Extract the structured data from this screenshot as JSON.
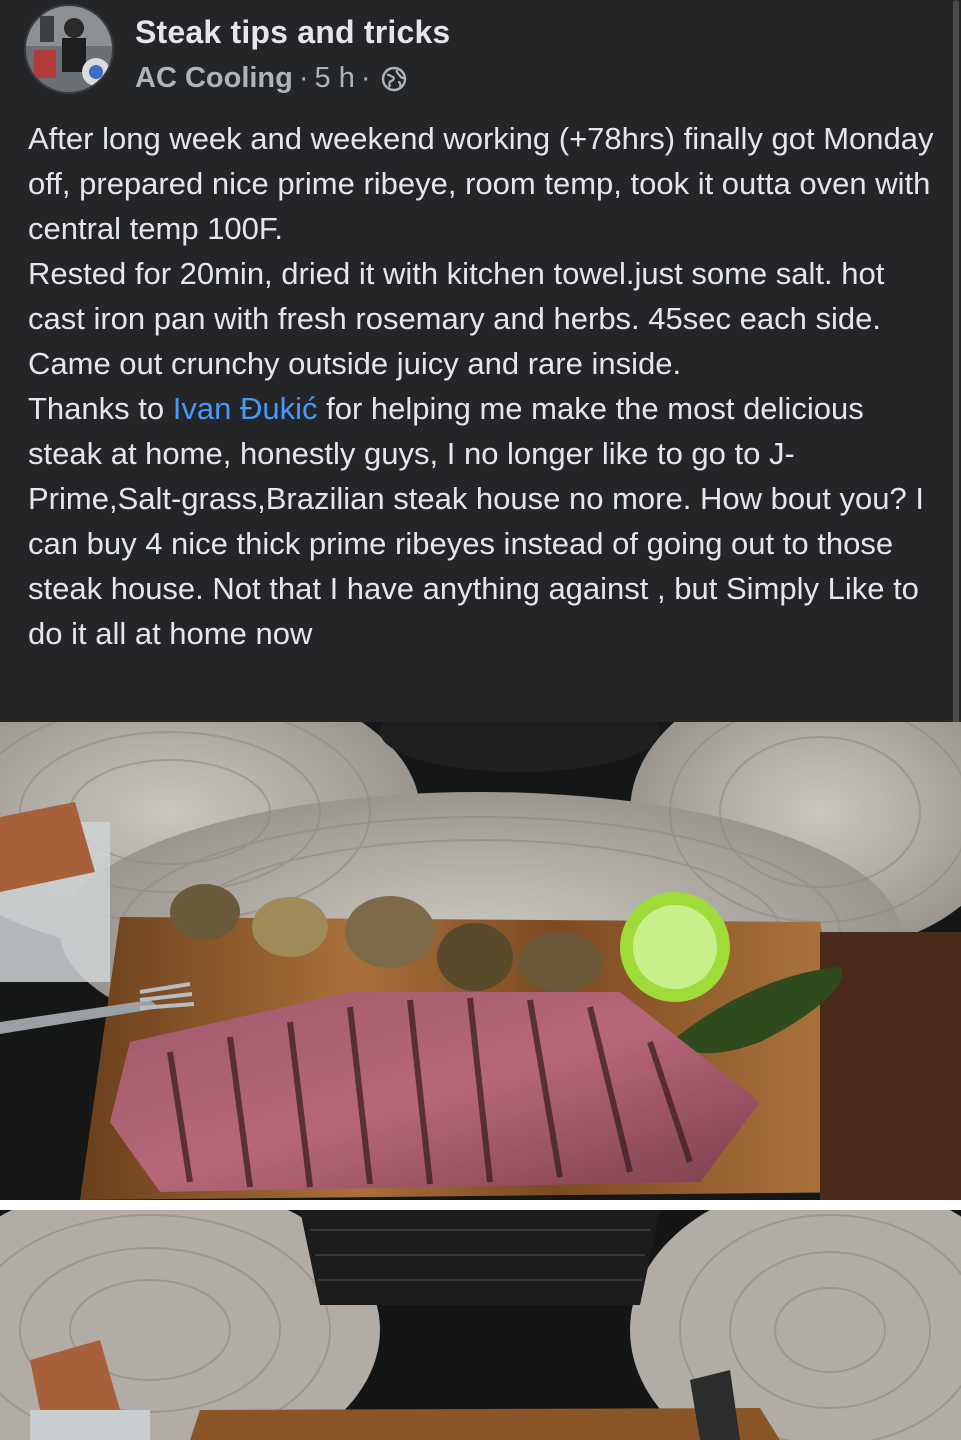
{
  "post": {
    "group_name": "Steak tips and tricks",
    "author": "AC Cooling",
    "separator1": "·",
    "time": "5 h",
    "separator2": "·",
    "privacy_icon": "globe-icon",
    "text_lines": [
      "After long week and weekend working (+78hrs) finally got Monday off, prepared nice prime ribeye, room temp, took it outta oven with central temp 100F.",
      "Rested for 20min, dried it with kitchen towel.just some salt. hot cast iron pan with fresh rosemary and herbs. 45sec each side.",
      "Came out crunchy outside juicy and rare inside."
    ],
    "thanks_prefix": "Thanks to ",
    "mention": "Ivan Đukić",
    "thanks_suffix": " for helping me make the most delicious steak at home, honestly guys, I no longer like to go to J-Prime,Salt-grass,Brazilian steak house no more. How bout you? I can buy 4 nice thick prime ribeyes instead of going out to those steak house. Not that I have anything against , but Simply Like to do it all at home now"
  },
  "colors": {
    "background": "#242526",
    "text": "#e4e6eb",
    "secondary_text": "#b0b3b8",
    "link": "#4599ff"
  }
}
